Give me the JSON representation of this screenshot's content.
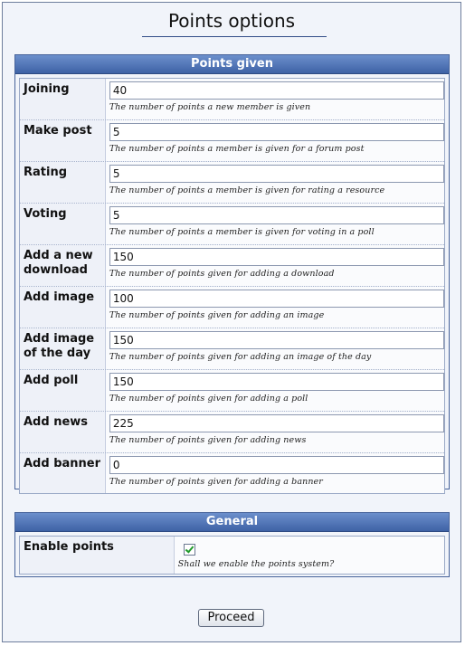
{
  "page": {
    "title": "Points options"
  },
  "points_given": {
    "header": "Points given",
    "rows": [
      {
        "label": "Joining",
        "value": "40",
        "hint": "The number of points a new member is given"
      },
      {
        "label": "Make post",
        "value": "5",
        "hint": "The number of points a member is given for a forum post"
      },
      {
        "label": "Rating",
        "value": "5",
        "hint": "The number of points a member is given for rating a resource"
      },
      {
        "label": "Voting",
        "value": "5",
        "hint": "The number of points a member is given for voting in a poll"
      },
      {
        "label": "Add a new download",
        "value": "150",
        "hint": "The number of points given for adding a download"
      },
      {
        "label": "Add image",
        "value": "100",
        "hint": "The number of points given for adding an image"
      },
      {
        "label": "Add image of the day",
        "value": "150",
        "hint": "The number of points given for adding an image of the day"
      },
      {
        "label": "Add poll",
        "value": "150",
        "hint": "The number of points given for adding a poll"
      },
      {
        "label": "Add news",
        "value": "225",
        "hint": "The number of points given for adding news"
      },
      {
        "label": "Add banner",
        "value": "0",
        "hint": "The number of points given for adding a banner"
      }
    ]
  },
  "general": {
    "header": "General",
    "enable_points": {
      "label": "Enable points",
      "checked": true,
      "hint": "Shall we enable the points system?"
    }
  },
  "proceed_label": "Proceed",
  "colors": {
    "panel_header": "#3e62a5",
    "check": "#1f9a2a"
  }
}
